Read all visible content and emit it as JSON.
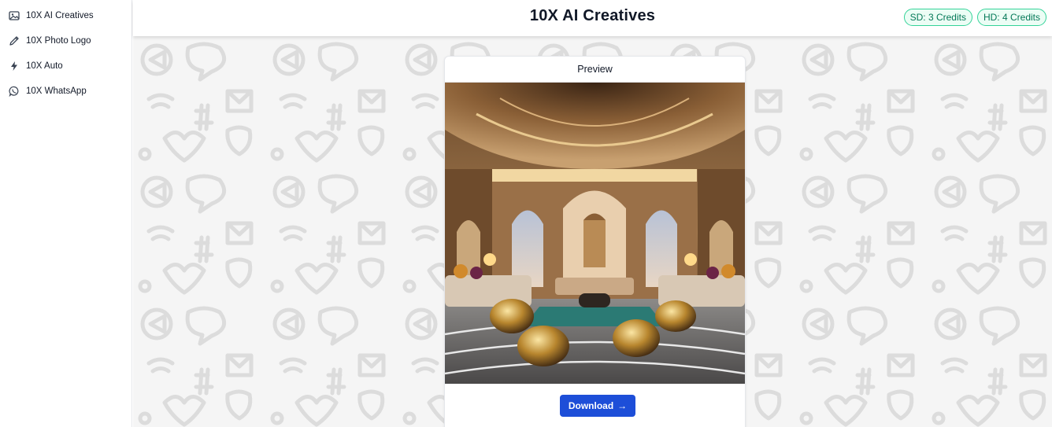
{
  "sidebar": {
    "items": [
      {
        "label": "10X AI Creatives",
        "icon": "image-icon"
      },
      {
        "label": "10X Photo Logo",
        "icon": "pencil-icon"
      },
      {
        "label": "10X Auto",
        "icon": "lightning-icon"
      },
      {
        "label": "10X WhatsApp",
        "icon": "whatsapp-icon"
      }
    ]
  },
  "header": {
    "title": "10X AI Creatives",
    "sd_credits": "SD: 3 Credits",
    "hd_credits": "HD: 4 Credits"
  },
  "preview_card": {
    "heading": "Preview",
    "image_alt": "Ornate palatial lounge interior with carved arches, domed ceiling, sofas and gold poufs",
    "download_label": "Download",
    "download_icon": "→"
  },
  "colors": {
    "badge_green": "#047857",
    "download_blue": "#1d4ed8",
    "pattern_bg": "#f4f4f4"
  }
}
